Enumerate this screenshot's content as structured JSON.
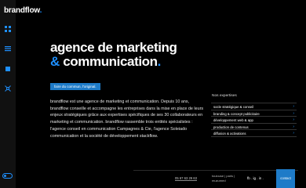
{
  "brand": {
    "name": "brandflow",
    "dot": "."
  },
  "headline": {
    "line1": "agence de marketing",
    "amp": "&",
    "line2": "communication",
    "dot": "."
  },
  "tagline": "faire du commun, l'original.",
  "body": "brandflow est une agence de marketing et communication. Depuis 10 ans, brandflow conseille et accompagne les entreprises dans la mise en place de leurs enjeux stratégiques grâce aux expertises spécifiques de ses 30 collaborateurs en marketing et communication. brandflow rassemble trois entités spécialistes : l'agence conseil en communication Campagnes & Cie, l'agence Soleiado communication et la société de développement stackflow.",
  "expertises": {
    "title": "Nos expertises",
    "items": [
      {
        "label": "socle stratégique & conseil"
      },
      {
        "label": "branding & concept publicitaire"
      },
      {
        "label": "développement web & app"
      },
      {
        "label": "production de contenus"
      },
      {
        "label": "diffusion & activations"
      }
    ]
  },
  "footer": {
    "phone": "05 67 63 29 63",
    "address": [
      "toulouse | paris |",
      "muzumed"
    ],
    "socials": "fb . ig . in .",
    "contact": "contact"
  },
  "colors": {
    "accent": "#1e90ff",
    "bg": "#000000",
    "sidebar": "#111111"
  }
}
